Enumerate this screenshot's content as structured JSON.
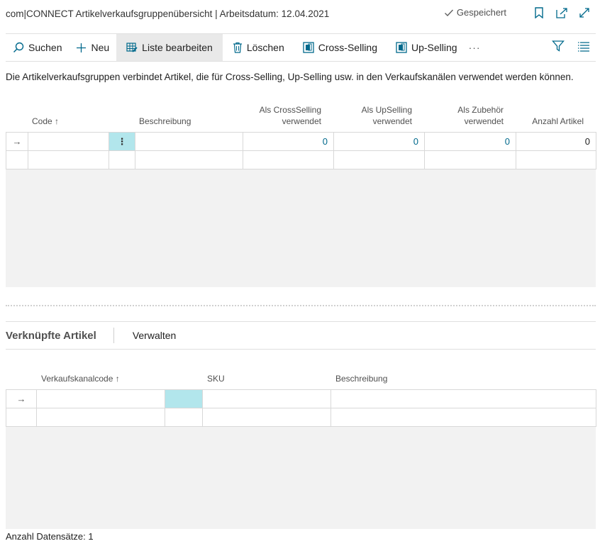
{
  "window": {
    "title": "com|CONNECT Artikelverkaufsgruppenübersicht | Arbeitsdatum: 12.04.2021",
    "saved_label": "Gespeichert",
    "icons": [
      "bookmark-icon",
      "open-new-window-icon",
      "expand-icon"
    ]
  },
  "toolbar": {
    "search": "Suchen",
    "new": "Neu",
    "edit_list": "Liste bearbeiten",
    "delete": "Löschen",
    "cross_selling": "Cross-Selling",
    "up_selling": "Up-Selling",
    "more": "···"
  },
  "description": "Die Artikelverkaufsgruppen verbindet Artikel, die für Cross-Selling, Up-Selling usw. in den Verkaufskanälen verwendet werden können.",
  "main_grid": {
    "columns": {
      "code": "Code",
      "sort_arrow": "↑",
      "beschreibung": "Beschreibung",
      "cross_line1": "Als CrossSelling",
      "cross_line2": "verwendet",
      "up_line1": "Als UpSelling",
      "up_line2": "verwendet",
      "zub_line1": "Als Zubehör",
      "zub_line2": "verwendet",
      "anzahl": "Anzahl Artikel"
    },
    "row": {
      "marker": "→",
      "menu": "⋮",
      "cross": "0",
      "up": "0",
      "zub": "0",
      "anzahl": "0"
    }
  },
  "subpage": {
    "title": "Verknüpfte Artikel",
    "action": "Verwalten",
    "columns": {
      "kanal": "Verkaufskanalcode",
      "sort_arrow": "↑",
      "sku": "SKU",
      "beschreibung": "Beschreibung"
    },
    "row": {
      "marker": "→"
    }
  },
  "footer": "Anzahl Datensätze: 1",
  "colors": {
    "accent": "#00698c",
    "selection": "#b2e6ec"
  }
}
